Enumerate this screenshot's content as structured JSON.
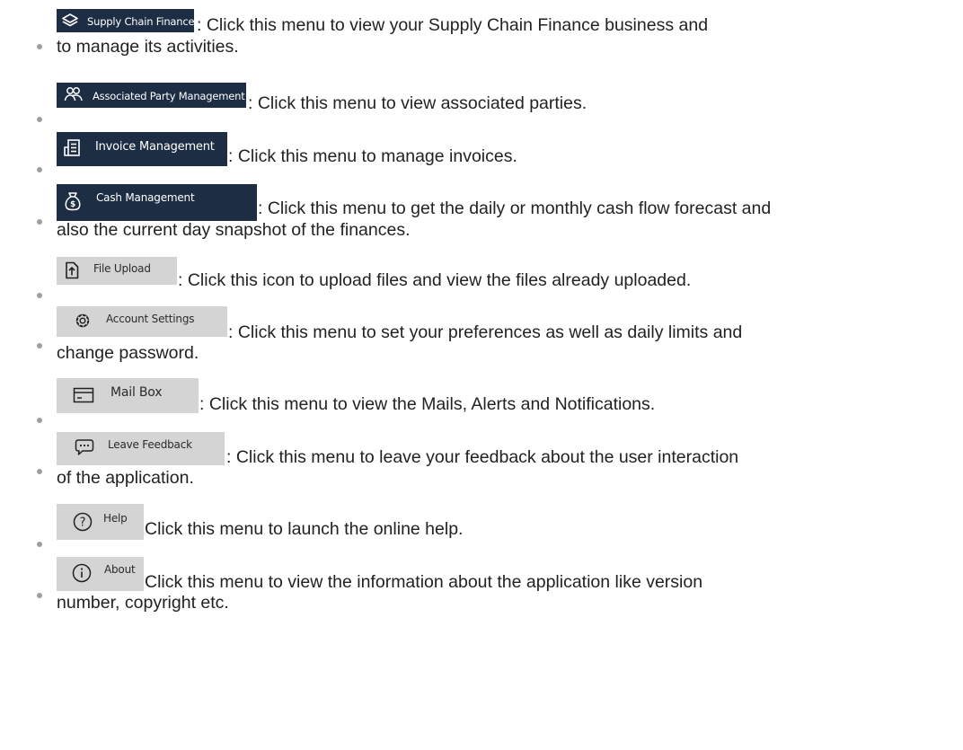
{
  "items": [
    {
      "icon": "layers-icon",
      "label": "Supply Chain Finance",
      "line1": ": Click this menu to view your Supply Chain Finance business and",
      "line2": "to manage its activities."
    },
    {
      "icon": "users-icon",
      "label": "Associated Party Management",
      "line1": ": Click this menu to view associated parties."
    },
    {
      "icon": "invoice-icon",
      "label": "Invoice Management",
      "line1": ": Click this menu to manage invoices."
    },
    {
      "icon": "money-bag-icon",
      "label": "Cash Management",
      "line1": ": Click this menu to get the daily or monthly cash flow forecast and",
      "line2": "also the current day snapshot of the finances."
    },
    {
      "icon": "file-upload-icon",
      "label": "File Upload",
      "line1": ": Click this icon to upload files and view the files already uploaded."
    },
    {
      "icon": "gear-icon",
      "label": "Account Settings",
      "line1": ": Click this menu to set your preferences as well as daily limits and",
      "line2": "change password."
    },
    {
      "icon": "mail-icon",
      "label": "Mail Box",
      "line1": ": Click this menu to view the Mails, Alerts and Notifications."
    },
    {
      "icon": "chat-bubble-icon",
      "label": "Leave Feedback",
      "line1": ": Click this menu to leave your feedback about the user interaction",
      "line2": "of the application."
    },
    {
      "icon": "help-icon",
      "label": "Help",
      "line1": "Click this menu to launch the online help."
    },
    {
      "icon": "info-icon",
      "label": "About",
      "line1": "Click this menu to view the information about the application like version",
      "line2": "number, copyright etc."
    }
  ]
}
